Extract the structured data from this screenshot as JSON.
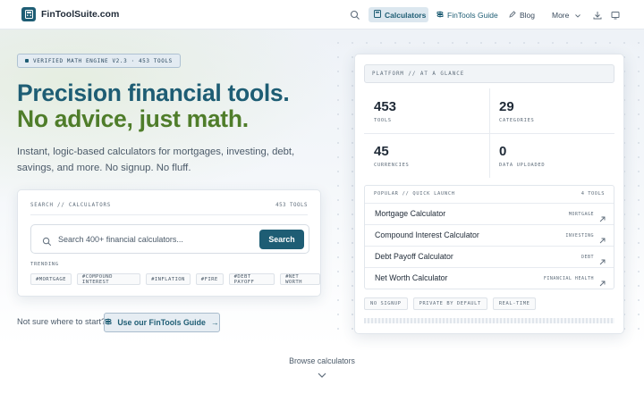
{
  "brand": {
    "name": "FinToolSuite.com"
  },
  "nav": {
    "items": [
      {
        "label": "Calculators",
        "icon": "calculator-icon"
      },
      {
        "label": "FinTools Guide",
        "icon": "signpost-icon"
      },
      {
        "label": "Blog",
        "icon": "pencil-icon"
      },
      {
        "label": "More",
        "icon": "chevron-down-icon"
      }
    ],
    "icons": [
      "search-icon",
      "download-icon",
      "monitor-icon"
    ]
  },
  "hero": {
    "badge": "VERIFIED MATH ENGINE V2.3 · 453 TOOLS",
    "headline_line1": "Precision financial tools.",
    "headline_line2": "No advice, just math.",
    "subtitle": "Instant, logic-based calculators for mortgages, investing, debt, savings, and more. No signup. No fluff."
  },
  "search": {
    "label": "SEARCH // CALCULATORS",
    "count": "453 TOOLS",
    "placeholder": "Search 400+ financial calculators...",
    "button": "Search",
    "trending_label": "TRENDING",
    "trending": [
      "#MORTGAGE",
      "#COMPOUND INTEREST",
      "#INFLATION",
      "#FIRE",
      "#DEBT PAYOFF",
      "#NET WORTH"
    ]
  },
  "cta": {
    "question": "Not sure where to start?",
    "button": "Use our FinTools Guide",
    "arrow": "→"
  },
  "panel": {
    "header": "PLATFORM // AT A GLANCE",
    "stats": [
      {
        "value": "453",
        "label": "TOOLS"
      },
      {
        "value": "29",
        "label": "CATEGORIES"
      },
      {
        "value": "45",
        "label": "CURRENCIES"
      },
      {
        "value": "0",
        "label": "DATA UPLOADED"
      }
    ],
    "quick_launch": {
      "label": "POPULAR // QUICK LAUNCH",
      "count": "4 TOOLS",
      "items": [
        {
          "name": "Mortgage Calculator",
          "tag": "MORTGAGE"
        },
        {
          "name": "Compound Interest Calculator",
          "tag": "INVESTING"
        },
        {
          "name": "Debt Payoff Calculator",
          "tag": "DEBT"
        },
        {
          "name": "Net Worth Calculator",
          "tag": "FINANCIAL HEALTH"
        }
      ]
    },
    "pills": [
      "NO SIGNUP",
      "PRIVATE BY DEFAULT",
      "REAL-TIME"
    ]
  },
  "browse": {
    "label": "Browse calculators"
  },
  "colors": {
    "primary": "#1e5d74",
    "accent_green": "#4f7d2a",
    "text": "#1f2a37",
    "muted": "#5f6d7b"
  }
}
